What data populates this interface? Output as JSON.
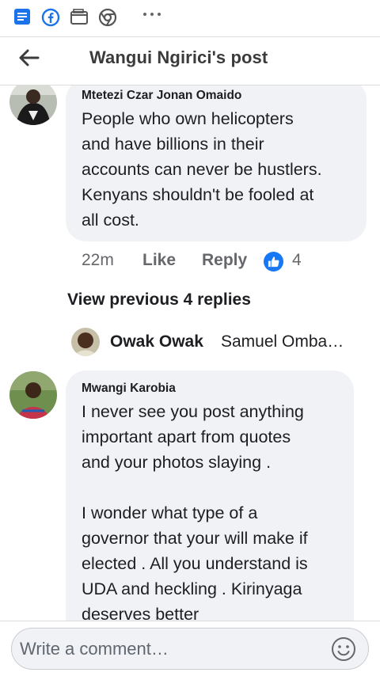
{
  "header": {
    "title": "Wangui Ngirici's post"
  },
  "comments": [
    {
      "author": "Mtetezi Czar Jonan Omaido",
      "text": "People who own helicopters\nand have billions in their\naccounts can never be hustlers.\nKenyans shouldn't be fooled at\nall cost.",
      "time": "22m",
      "like_label": "Like",
      "reply_label": "Reply",
      "reaction_count": "4"
    },
    {
      "author": "Mwangi Karobia",
      "text": "I never see you post anything\nimportant apart from quotes\nand your photos slaying .\n\nI wonder what type of a\ngovernor that your will make if\nelected . All you understand is\nUDA and heckling . Kirinyaga\ndeserves better"
    }
  ],
  "view_previous_label": "View previous 4 replies",
  "reply_preview": {
    "name": "Owak Owak",
    "snippet": "Samuel Ombasa is"
  },
  "composer": {
    "placeholder": "Write a comment…"
  },
  "colors": {
    "accent": "#1877f2",
    "bubble": "#f0f2f5",
    "secondary_text": "#65676b"
  }
}
